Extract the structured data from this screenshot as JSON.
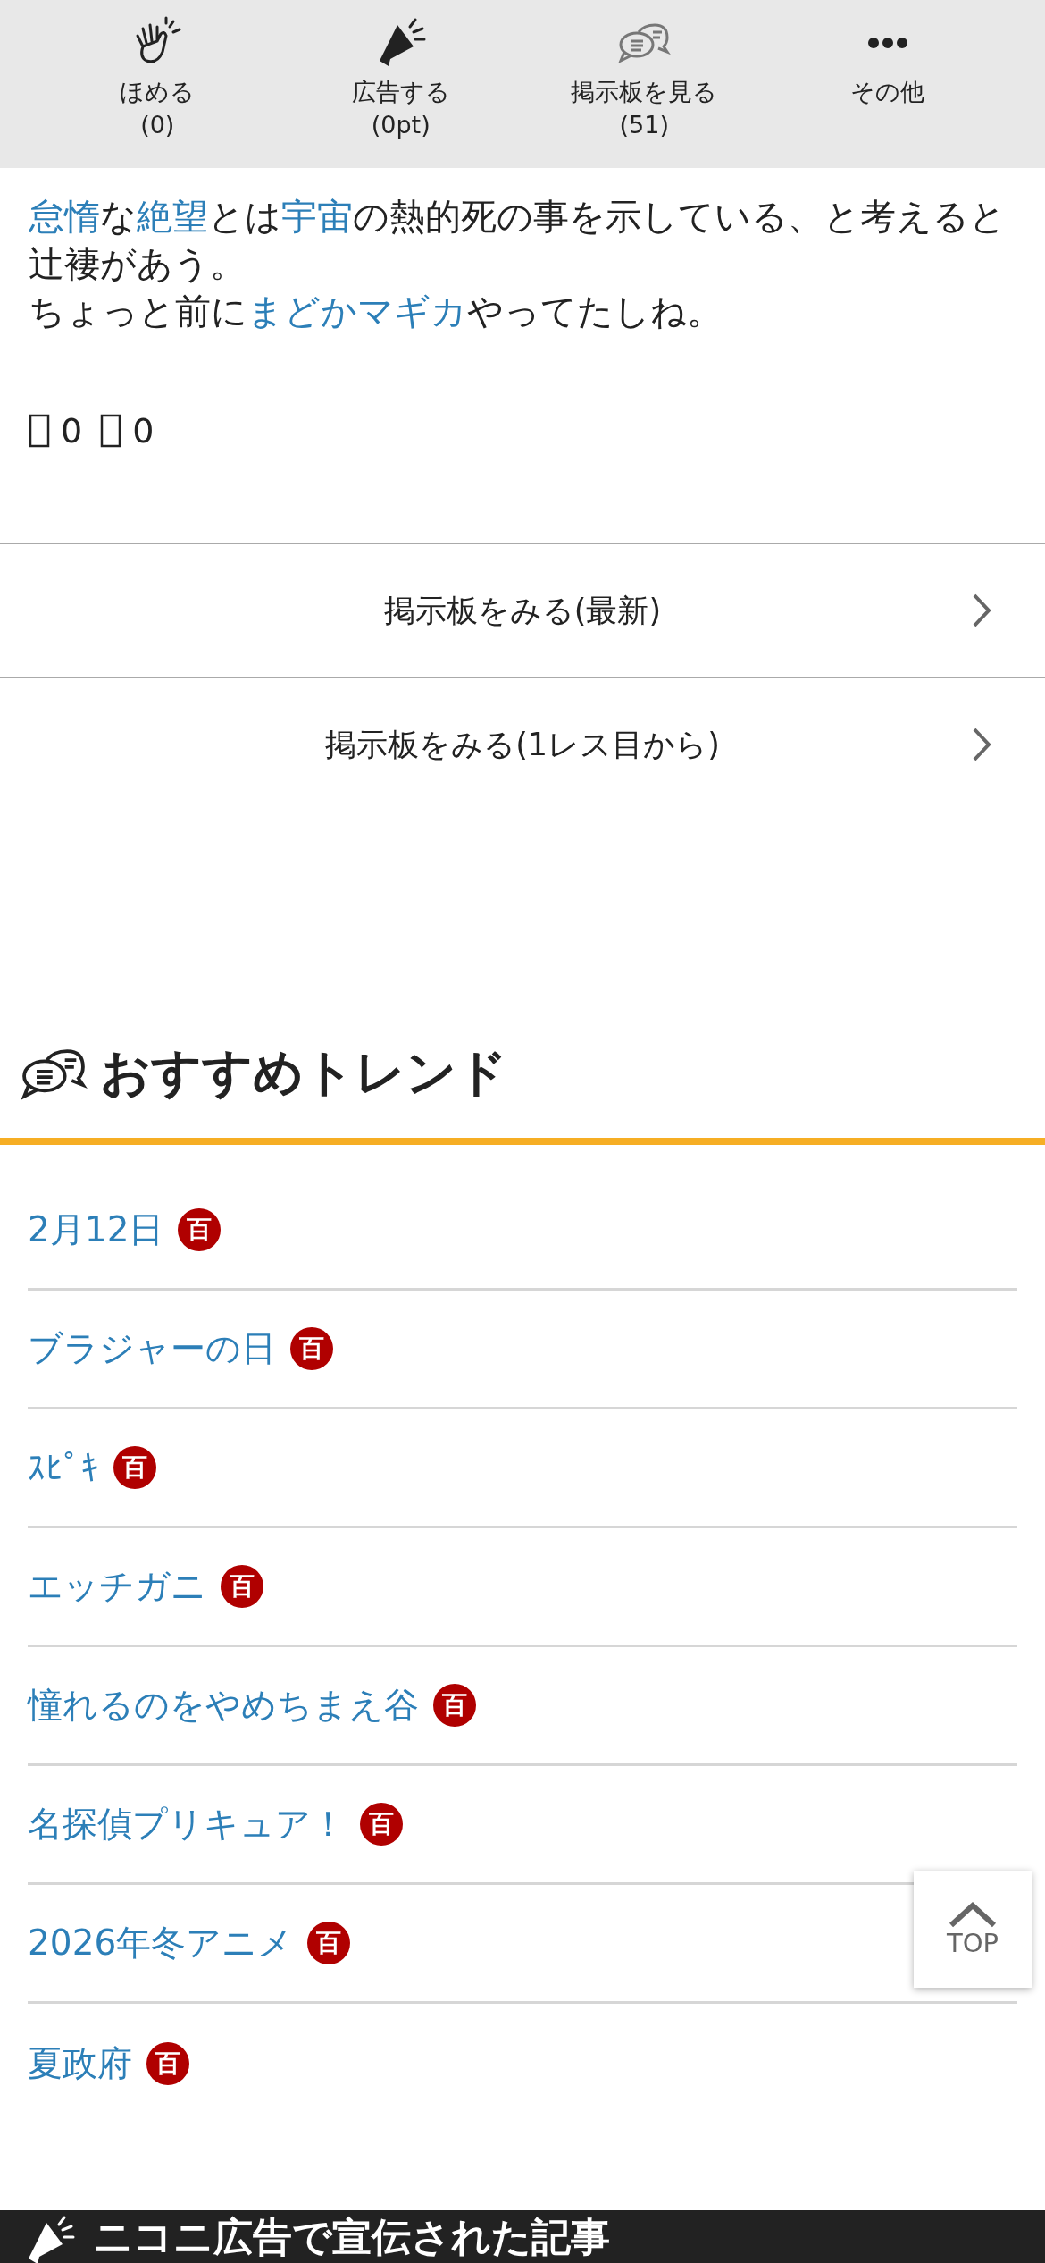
{
  "toolbar": [
    {
      "kind": "clap",
      "label": "ほめる",
      "count": "(0)"
    },
    {
      "kind": "megaphone",
      "label": "広告する",
      "count": "(0pt)"
    },
    {
      "kind": "chat",
      "label": "掲示板を見る",
      "count": "(51)"
    },
    {
      "kind": "more",
      "label": "その他"
    }
  ],
  "article": {
    "paragraphs": [
      [
        {
          "text": "怠惰",
          "kind": "link"
        },
        {
          "text": "な",
          "kind": "text"
        },
        {
          "text": "絶望",
          "kind": "link"
        },
        {
          "text": "とは",
          "kind": "text"
        },
        {
          "text": "宇宙",
          "kind": "link"
        },
        {
          "text": "の熱的死の事を示している、と考えると辻褄があう。",
          "kind": "text"
        }
      ],
      [
        {
          "text": "ちょっと前に",
          "kind": "text"
        },
        {
          "text": "まどかマギカ",
          "kind": "link"
        },
        {
          "text": "やってたしね。",
          "kind": "text"
        }
      ]
    ],
    "reactions": [
      {
        "count": "0"
      },
      {
        "count": "0"
      }
    ]
  },
  "board_links": [
    {
      "label": "掲示板をみる(最新)"
    },
    {
      "label": "掲示板をみる(1レス目から)"
    }
  ],
  "trends": {
    "title": "おすすめトレンド",
    "items": [
      {
        "label": "2月12日",
        "badge": "百"
      },
      {
        "label": "ブラジャーの日",
        "badge": "百"
      },
      {
        "label": "ｽﾋﾟｷ",
        "badge": "百"
      },
      {
        "label": "エッチガニ",
        "badge": "百"
      },
      {
        "label": "憧れるのをやめちまえ谷",
        "badge": "百"
      },
      {
        "label": "名探偵プリキュア！",
        "badge": "百"
      },
      {
        "label": "2026年冬アニメ",
        "badge": "百"
      },
      {
        "label": "夏政府",
        "badge": "百"
      }
    ]
  },
  "top_button": {
    "label": "TOP"
  },
  "ad_section": {
    "title": "ニコニ広告で宣伝された記事"
  }
}
